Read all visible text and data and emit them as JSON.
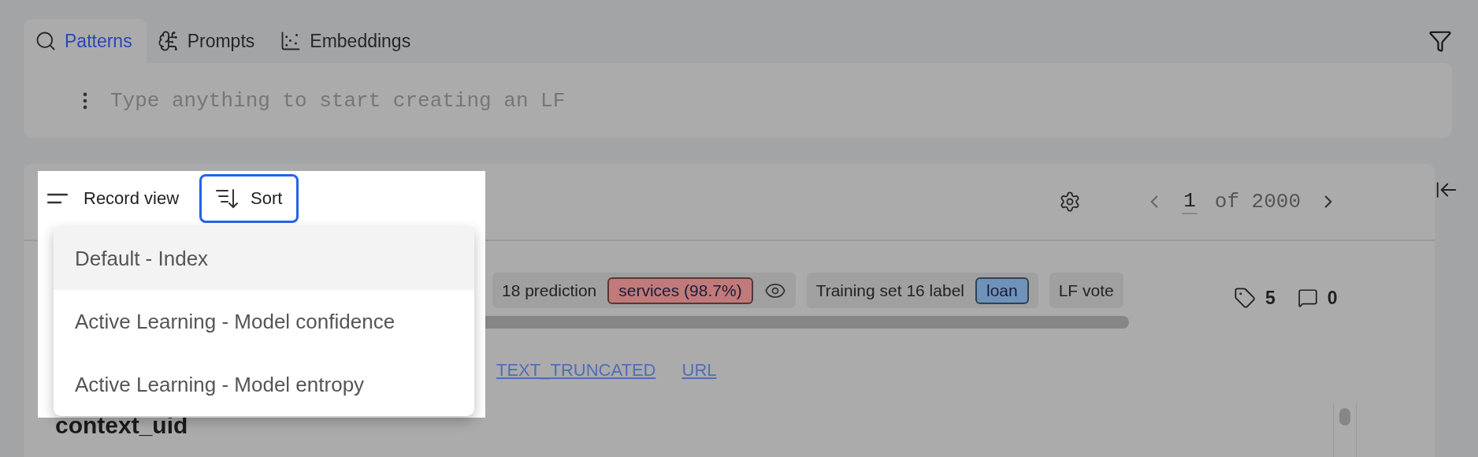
{
  "tabs": [
    {
      "label": "Patterns",
      "selected": true
    },
    {
      "label": "Prompts",
      "selected": false
    },
    {
      "label": "Embeddings",
      "selected": false
    }
  ],
  "search": {
    "placeholder": "Type anything to start creating an LF"
  },
  "toolbar": {
    "record_view": "Record view",
    "sort": "Sort"
  },
  "sort_menu": [
    {
      "label": "Default - Index",
      "selected": true
    },
    {
      "label": "Active Learning - Model confidence",
      "selected": false
    },
    {
      "label": "Active Learning - Model entropy",
      "selected": false
    }
  ],
  "pager": {
    "current": "1",
    "total": "of 2000"
  },
  "chips": [
    {
      "label": "18 prediction",
      "badge": "services (98.7%)",
      "color": "#c07a7a",
      "eye": true
    },
    {
      "label": "Training set 16 label",
      "badge": "loan",
      "color": "#6f93b8",
      "eye": false
    },
    {
      "label": "LF vote",
      "eye": false
    }
  ],
  "counts": {
    "tags": "5",
    "comments": "0"
  },
  "links": [
    "TEXT_TRUNCATED",
    "URL"
  ],
  "field_title": "context_uid"
}
